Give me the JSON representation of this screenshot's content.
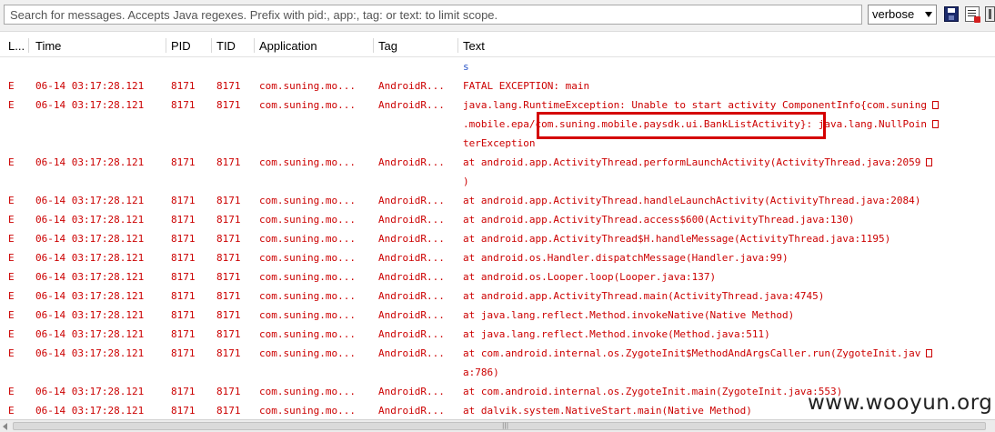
{
  "toolbar": {
    "search_placeholder": "Search for messages. Accepts Java regexes. Prefix with pid:, app:, tag: or text: to limit scope.",
    "level": "verbose",
    "icons": [
      "save-icon",
      "clear-log-icon",
      "scroll-lock-icon"
    ]
  },
  "columns": [
    "L...",
    "Time",
    "PID",
    "TID",
    "Application",
    "Tag",
    "Text"
  ],
  "rows": [
    {
      "level": "",
      "time": "",
      "pid": "",
      "tid": "",
      "app": "",
      "tag": "",
      "text": "s"
    },
    {
      "level": "E",
      "time": "06-14 03:17:28.121",
      "pid": "8171",
      "tid": "8171",
      "app": "com.suning.mo...",
      "tag": "AndroidR...",
      "text": "FATAL EXCEPTION: main"
    },
    {
      "level": "E",
      "time": "06-14 03:17:28.121",
      "pid": "8171",
      "tid": "8171",
      "app": "com.suning.mo...",
      "tag": "AndroidR...",
      "text": "java.lang.RuntimeException: Unable to start activity ComponentInfo{com.suning",
      "cont": [
        ".mobile.epa/com.suning.mobile.paysdk.ui.BankListActivity}: java.lang.NullPoin",
        "terException"
      ]
    },
    {
      "level": "E",
      "time": "06-14 03:17:28.121",
      "pid": "8171",
      "tid": "8171",
      "app": "com.suning.mo...",
      "tag": "AndroidR...",
      "text": "at android.app.ActivityThread.performLaunchActivity(ActivityThread.java:2059",
      "cont": [
        ")"
      ]
    },
    {
      "level": "E",
      "time": "06-14 03:17:28.121",
      "pid": "8171",
      "tid": "8171",
      "app": "com.suning.mo...",
      "tag": "AndroidR...",
      "text": "at android.app.ActivityThread.handleLaunchActivity(ActivityThread.java:2084)"
    },
    {
      "level": "E",
      "time": "06-14 03:17:28.121",
      "pid": "8171",
      "tid": "8171",
      "app": "com.suning.mo...",
      "tag": "AndroidR...",
      "text": "at android.app.ActivityThread.access$600(ActivityThread.java:130)"
    },
    {
      "level": "E",
      "time": "06-14 03:17:28.121",
      "pid": "8171",
      "tid": "8171",
      "app": "com.suning.mo...",
      "tag": "AndroidR...",
      "text": "at android.app.ActivityThread$H.handleMessage(ActivityThread.java:1195)"
    },
    {
      "level": "E",
      "time": "06-14 03:17:28.121",
      "pid": "8171",
      "tid": "8171",
      "app": "com.suning.mo...",
      "tag": "AndroidR...",
      "text": "at android.os.Handler.dispatchMessage(Handler.java:99)"
    },
    {
      "level": "E",
      "time": "06-14 03:17:28.121",
      "pid": "8171",
      "tid": "8171",
      "app": "com.suning.mo...",
      "tag": "AndroidR...",
      "text": "at android.os.Looper.loop(Looper.java:137)"
    },
    {
      "level": "E",
      "time": "06-14 03:17:28.121",
      "pid": "8171",
      "tid": "8171",
      "app": "com.suning.mo...",
      "tag": "AndroidR...",
      "text": "at android.app.ActivityThread.main(ActivityThread.java:4745)"
    },
    {
      "level": "E",
      "time": "06-14 03:17:28.121",
      "pid": "8171",
      "tid": "8171",
      "app": "com.suning.mo...",
      "tag": "AndroidR...",
      "text": "at java.lang.reflect.Method.invokeNative(Native Method)"
    },
    {
      "level": "E",
      "time": "06-14 03:17:28.121",
      "pid": "8171",
      "tid": "8171",
      "app": "com.suning.mo...",
      "tag": "AndroidR...",
      "text": "at java.lang.reflect.Method.invoke(Method.java:511)"
    },
    {
      "level": "E",
      "time": "06-14 03:17:28.121",
      "pid": "8171",
      "tid": "8171",
      "app": "com.suning.mo...",
      "tag": "AndroidR...",
      "text": "at com.android.internal.os.ZygoteInit$MethodAndArgsCaller.run(ZygoteInit.jav",
      "cont": [
        "a:786)"
      ]
    },
    {
      "level": "E",
      "time": "06-14 03:17:28.121",
      "pid": "8171",
      "tid": "8171",
      "app": "com.suning.mo...",
      "tag": "AndroidR...",
      "text": "at com.android.internal.os.ZygoteInit.main(ZygoteInit.java:553)"
    },
    {
      "level": "E",
      "time": "06-14 03:17:28.121",
      "pid": "8171",
      "tid": "8171",
      "app": "com.suning.mo...",
      "tag": "AndroidR...",
      "text": "at dalvik.system.NativeStart.main(Native Method)"
    }
  ],
  "watermark": "www.wooyun.org",
  "colors": {
    "error_text": "#cc0000",
    "highlight_box": "#d40000"
  }
}
